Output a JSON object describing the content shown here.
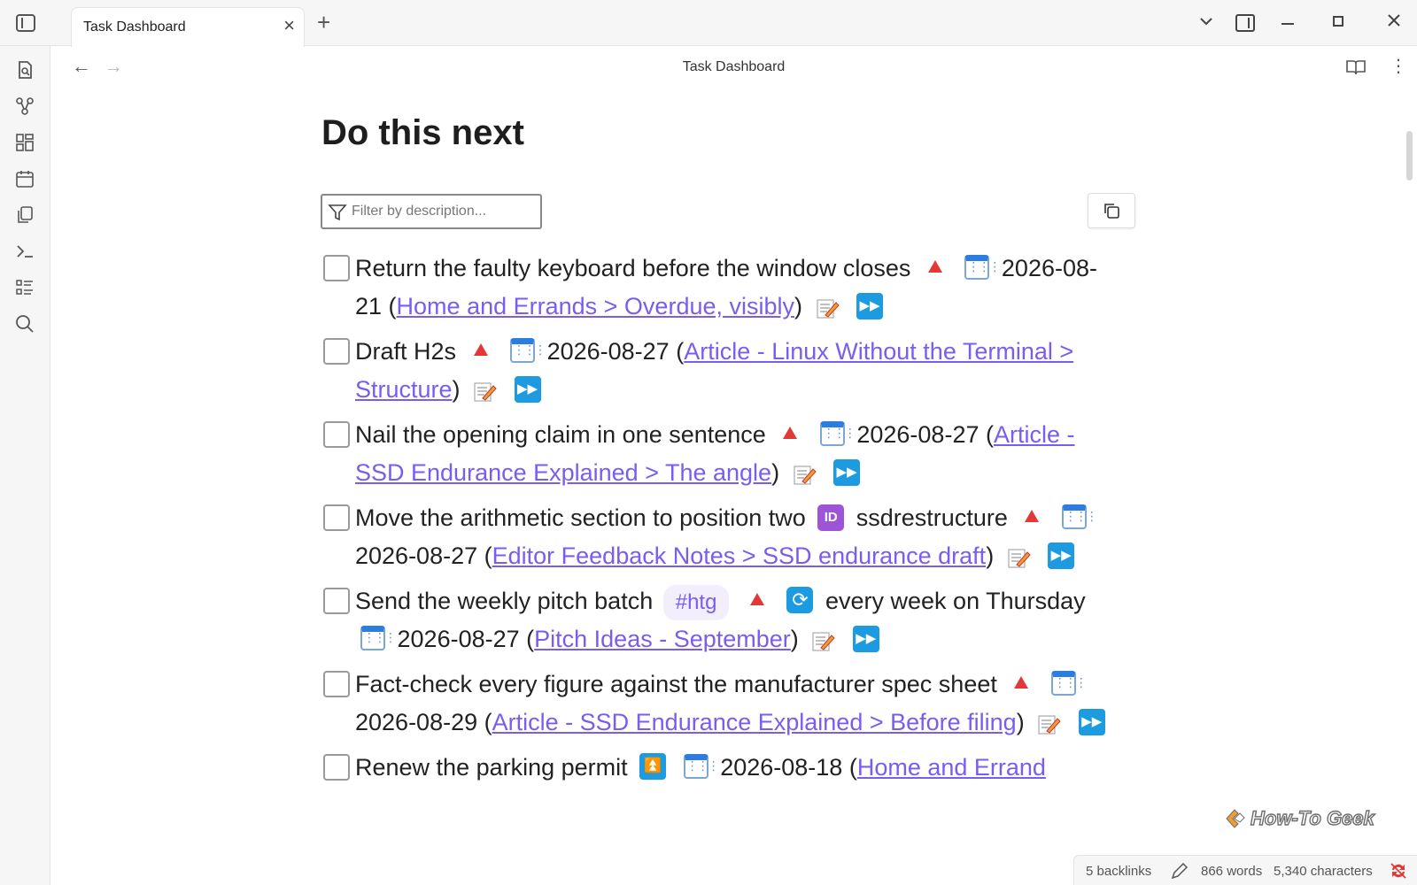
{
  "window": {
    "tab_title": "Task Dashboard",
    "tab_close": "×",
    "new_tab": "+",
    "header_title": "Task Dashboard"
  },
  "nav": {
    "back": "←",
    "forward": "→",
    "more": "⋮"
  },
  "page": {
    "heading": "Do this next",
    "filter_placeholder": "Filter by description..."
  },
  "tasks": [
    {
      "description": "Return the faulty keyboard before the window closes",
      "date": "2026-08-21",
      "link": "Home and Errands > Overdue, visibly"
    },
    {
      "description": "Draft H2s",
      "date": "2026-08-27",
      "link": "Article - Linux Without the Terminal > Structure"
    },
    {
      "description": "Nail the opening claim in one sentence",
      "date": "2026-08-27",
      "link": "Article - SSD Endurance Explained > The angle"
    },
    {
      "description": "Move the arithmetic section to position two",
      "id_value": "ssdrestructure",
      "date": "2026-08-27",
      "link": "Editor Feedback Notes > SSD endurance draft"
    },
    {
      "description": "Send the weekly pitch batch",
      "tag": "#htg",
      "recurrence": "every week on Thursday",
      "date": "2026-08-27",
      "link": "Pitch Ideas - September"
    },
    {
      "description": "Fact-check every figure against the manufacturer spec sheet",
      "date": "2026-08-29",
      "link": "Article - SSD Endurance Explained > Before filing"
    },
    {
      "description": "Renew the parking permit",
      "date": "2026-08-18",
      "link": "Home and Errand"
    }
  ],
  "status": {
    "backlinks": "5 backlinks",
    "words": "866 words",
    "characters": "5,340 characters"
  },
  "watermark": "How-To Geek",
  "icons": {
    "ribbon": [
      "file-search-icon",
      "graph-icon",
      "canvas-icon",
      "calendar-icon",
      "copy-pages-icon",
      "terminal-icon",
      "list-icon",
      "search-icon"
    ],
    "priority_high": "red-triangle",
    "priority_highest": "double-up-arrow",
    "due_date": "calendar",
    "edit": "pencil-memo",
    "postpone": "fast-forward",
    "id": "id-badge",
    "recurrence": "repeat"
  },
  "colors": {
    "link": "#7b5cf0",
    "priority": "#e23838",
    "action_blue": "#1d9be0",
    "id_purple": "#9b55d6"
  }
}
